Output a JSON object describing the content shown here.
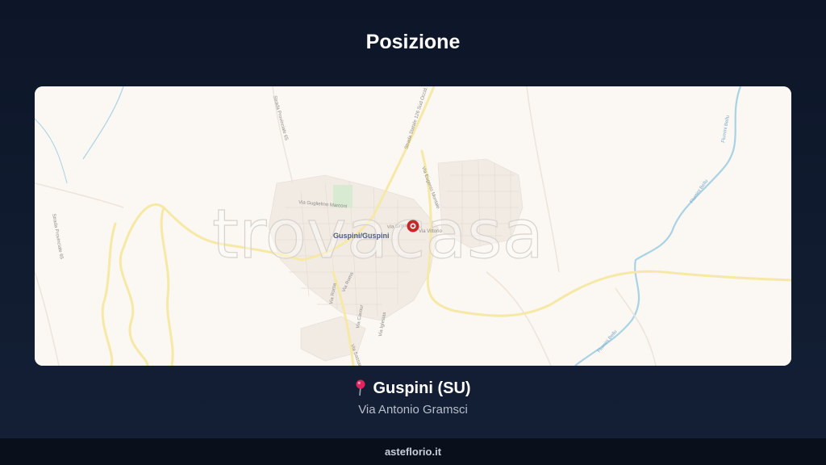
{
  "page": {
    "title": "Posizione"
  },
  "map": {
    "watermark": "trovacasa",
    "town_label": "Guspini/Guspini",
    "roads": {
      "sp65_north": "Strada Provinciale 65",
      "ss126": "Strada Statale 126 Sud Occid.",
      "via_eugenio": "Via Eugenio Montale",
      "via_gugliemo": "Via Guglielmo Marconi",
      "via_sp_west": "Strada Provinciale 65",
      "via_roma": "Via Roma",
      "via_roma2": "Via Roma",
      "via_sardegna": "Via Cavour",
      "via_iglesias": "Via Iglesias",
      "via_sassari": "Via Sassari",
      "via_vittorio": "Via Gramsci",
      "via_pin": "Via Vittorio"
    },
    "rivers": {
      "east": "Flumini Bellu",
      "east2": "Flumini Bellu"
    },
    "colors": {
      "background": "#fbf7f2",
      "road": "#f6e9a6",
      "river": "#a9d2e4",
      "marker": "#c62828"
    }
  },
  "location": {
    "pin_icon": "round-pushpin",
    "name": "Guspini (SU)",
    "address": "Via Antonio Gramsci"
  },
  "footer": {
    "site": "asteflorio.it"
  }
}
